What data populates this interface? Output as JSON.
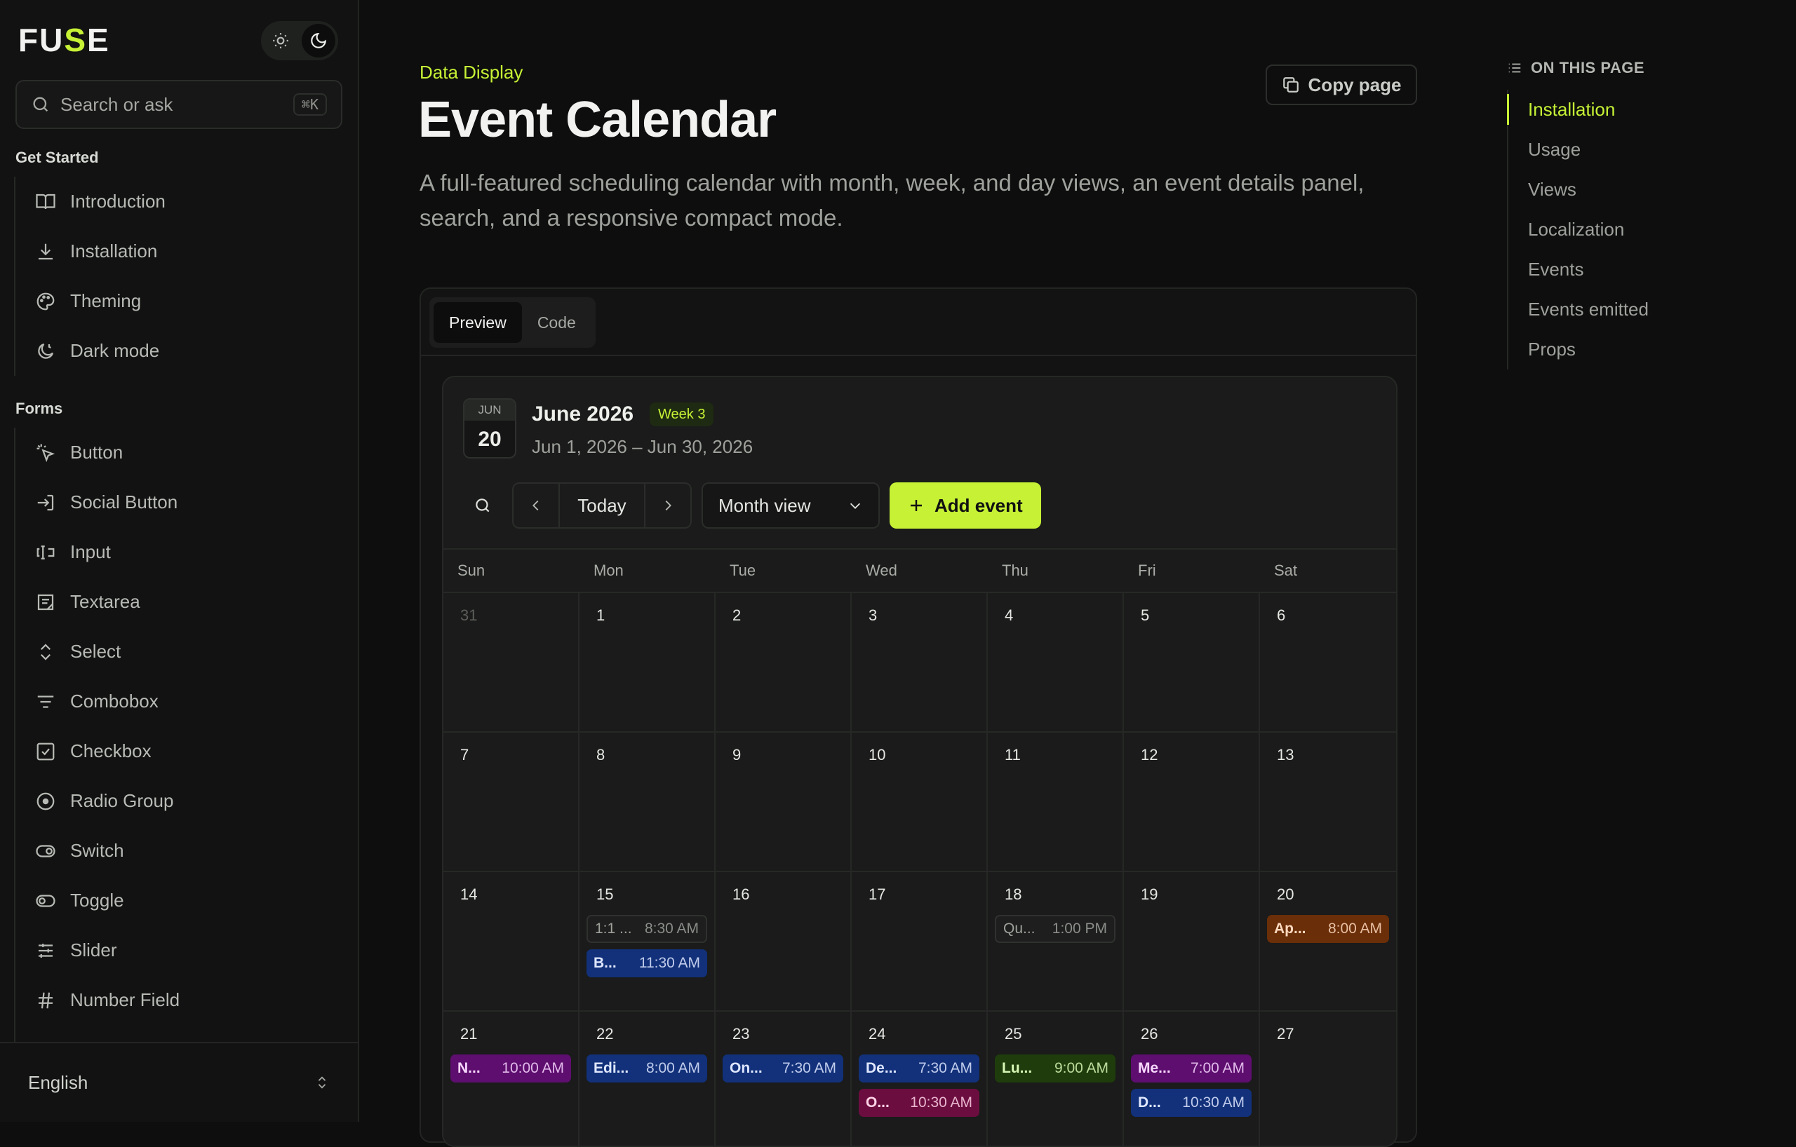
{
  "brand": {
    "logo_left": "FU",
    "logo_mid": "S",
    "logo_right": "E"
  },
  "search": {
    "placeholder": "Search or ask",
    "shortcut": "⌘K"
  },
  "sidebar": {
    "sections": [
      {
        "title": "Get Started",
        "items": [
          {
            "label": "Introduction",
            "icon": "book-icon"
          },
          {
            "label": "Installation",
            "icon": "download-icon"
          },
          {
            "label": "Theming",
            "icon": "palette-icon"
          },
          {
            "label": "Dark mode",
            "icon": "moon-clock-icon"
          }
        ]
      },
      {
        "title": "Forms",
        "items": [
          {
            "label": "Button",
            "icon": "pointer-click-icon"
          },
          {
            "label": "Social Button",
            "icon": "login-icon"
          },
          {
            "label": "Input",
            "icon": "text-cursor-input-icon"
          },
          {
            "label": "Textarea",
            "icon": "textarea-icon"
          },
          {
            "label": "Select",
            "icon": "chevrons-up-down-icon"
          },
          {
            "label": "Combobox",
            "icon": "list-filter-icon"
          },
          {
            "label": "Checkbox",
            "icon": "check-square-icon"
          },
          {
            "label": "Radio Group",
            "icon": "radio-icon"
          },
          {
            "label": "Switch",
            "icon": "toggle-right-icon"
          },
          {
            "label": "Toggle",
            "icon": "toggle-left-icon"
          },
          {
            "label": "Slider",
            "icon": "sliders-icon"
          },
          {
            "label": "Number Field",
            "icon": "hash-icon"
          }
        ]
      }
    ],
    "language": "English"
  },
  "page": {
    "breadcrumb": "Data Display",
    "title": "Event Calendar",
    "description": "A full-featured scheduling calendar with month, week, and day views, an event details panel, search, and a responsive compact mode.",
    "copy_label": "Copy page",
    "tabs": [
      "Preview",
      "Code"
    ]
  },
  "calendar": {
    "badge_month": "JUN",
    "badge_day": "20",
    "title": "June 2026",
    "week_badge": "Week 3",
    "range": "Jun 1, 2026 – Jun 30, 2026",
    "today_label": "Today",
    "view": "Month view",
    "add_label": "Add event",
    "weekdays": [
      "Sun",
      "Mon",
      "Tue",
      "Wed",
      "Thu",
      "Fri",
      "Sat"
    ],
    "weeks": [
      [
        {
          "n": "31",
          "muted": true
        },
        {
          "n": "1"
        },
        {
          "n": "2"
        },
        {
          "n": "3"
        },
        {
          "n": "4"
        },
        {
          "n": "5"
        },
        {
          "n": "6"
        }
      ],
      [
        {
          "n": "7"
        },
        {
          "n": "8"
        },
        {
          "n": "9"
        },
        {
          "n": "10"
        },
        {
          "n": "11"
        },
        {
          "n": "12"
        },
        {
          "n": "13"
        }
      ],
      [
        {
          "n": "14"
        },
        {
          "n": "15",
          "events": [
            {
              "title": "1:1 ...",
              "time": "8:30 AM",
              "color": "gray"
            },
            {
              "title": "B...",
              "time": "11:30 AM",
              "color": "blue"
            }
          ]
        },
        {
          "n": "16"
        },
        {
          "n": "17"
        },
        {
          "n": "18",
          "events": [
            {
              "title": "Qu...",
              "time": "1:00 PM",
              "color": "gray"
            }
          ]
        },
        {
          "n": "19"
        },
        {
          "n": "20",
          "events": [
            {
              "title": "Ap...",
              "time": "8:00 AM",
              "color": "orange"
            }
          ]
        }
      ],
      [
        {
          "n": "21",
          "events": [
            {
              "title": "N...",
              "time": "10:00 AM",
              "color": "purple"
            }
          ]
        },
        {
          "n": "22",
          "events": [
            {
              "title": "Edi...",
              "time": "8:00 AM",
              "color": "blue"
            }
          ]
        },
        {
          "n": "23",
          "events": [
            {
              "title": "On...",
              "time": "7:30 AM",
              "color": "blue"
            }
          ]
        },
        {
          "n": "24",
          "events": [
            {
              "title": "De...",
              "time": "7:30 AM",
              "color": "blue"
            },
            {
              "title": "O...",
              "time": "10:30 AM",
              "color": "pink"
            }
          ]
        },
        {
          "n": "25",
          "events": [
            {
              "title": "Lu...",
              "time": "9:00 AM",
              "color": "green"
            }
          ]
        },
        {
          "n": "26",
          "events": [
            {
              "title": "Me...",
              "time": "7:00 AM",
              "color": "purple"
            },
            {
              "title": "D...",
              "time": "10:30 AM",
              "color": "blue"
            }
          ]
        },
        {
          "n": "27"
        }
      ]
    ]
  },
  "toc": {
    "heading": "ON THIS PAGE",
    "items": [
      "Installation",
      "Usage",
      "Views",
      "Localization",
      "Events",
      "Events emitted",
      "Props"
    ],
    "active": 0
  },
  "colors": {
    "accent": "#c6f135"
  }
}
